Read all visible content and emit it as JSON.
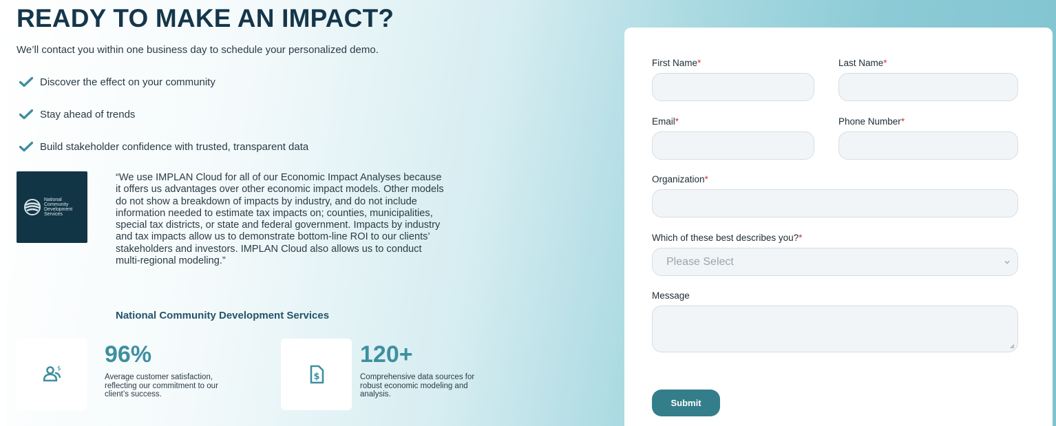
{
  "hero": {
    "headline": "READY TO MAKE AN IMPACT?",
    "subtitle": "We’ll contact you within one business day to schedule your personalized demo.",
    "checks": [
      "Discover the effect on your community",
      "Stay ahead of trends",
      "Build stakeholder confidence with trusted, transparent data"
    ]
  },
  "testimonial": {
    "logo_text": "National Community Development Services",
    "quote": "“We use IMPLAN Cloud for all of our Economic Impact Analyses because it offers us advantages over other economic impact models. Other models do not show a breakdown of impacts by industry, and do not include information needed to estimate tax impacts on; counties, municipalities, special tax districts, or state and federal government. Impacts by industry and tax impacts allow us to demonstrate bottom-line ROI to our clients’ stakeholders and investors. IMPLAN Cloud also allows us to conduct multi-regional modeling.”",
    "author": "National Community Development Services"
  },
  "stats": [
    {
      "value": "96%",
      "desc": "Average customer satisfaction, reflecting our commitment to our client’s success.",
      "icon": "users-dollar-icon"
    },
    {
      "value": "120+",
      "desc": "Comprehensive data sources for robust economic modeling and analysis.",
      "icon": "document-dollar-icon"
    }
  ],
  "form": {
    "first_name_label": "First Name",
    "last_name_label": "Last Name",
    "email_label": "Email",
    "phone_label": "Phone Number",
    "organization_label": "Organization",
    "describes_label": "Which of these best describes you?",
    "describes_selected": "Please Select",
    "message_label": "Message",
    "required_mark": "*",
    "submit_label": "Submit"
  },
  "colors": {
    "headline": "#15364a",
    "accent": "#3e8fa0",
    "submit_bg": "#347e8b",
    "required": "#d3343d",
    "logo_bg": "#123545"
  }
}
